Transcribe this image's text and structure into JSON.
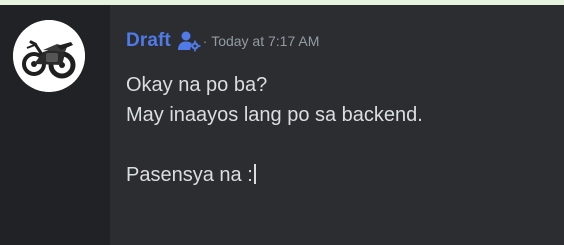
{
  "message": {
    "author": "Draft",
    "separator": "·",
    "timestamp": "Today at 7:17 AM",
    "role_icon": "user-gear-icon",
    "avatar_icon": "motorcycle-icon",
    "lines": [
      "Okay na po ba?",
      "May inaayos lang po sa backend.",
      "",
      "Pasensya na :"
    ]
  },
  "colors": {
    "background": "#2b2d31",
    "gutter": "#202226",
    "author": "#4f7ae8",
    "text": "#dbdee1",
    "muted": "#949ba4"
  }
}
